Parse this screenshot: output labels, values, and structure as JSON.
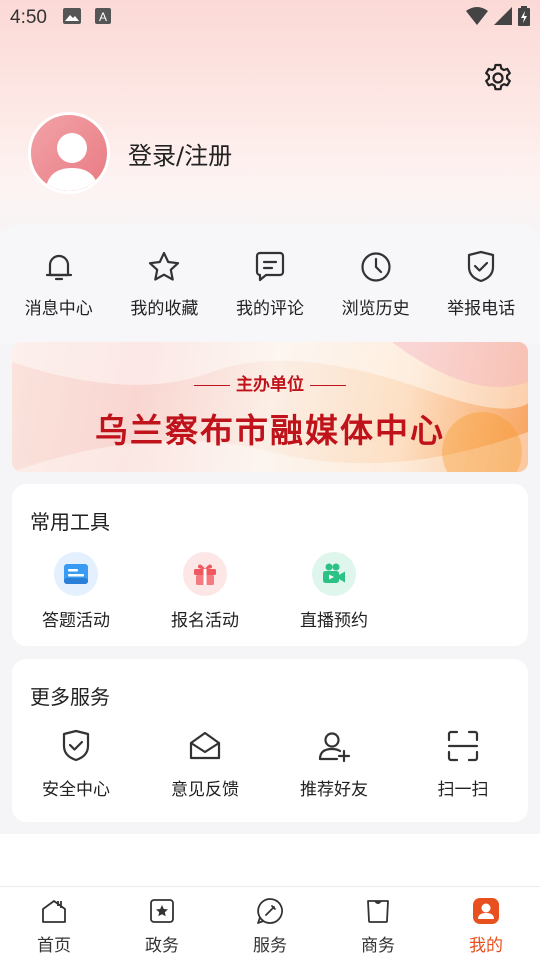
{
  "status_bar": {
    "time": "4:50",
    "icons_left": [
      "image-icon",
      "a-icon"
    ],
    "icons_right": [
      "wifi-icon",
      "signal-icon",
      "battery-icon"
    ]
  },
  "header": {
    "settings_icon": "gear-icon",
    "login_label": "登录/注册"
  },
  "quick_actions": [
    {
      "label": "消息中心",
      "icon": "bell-icon"
    },
    {
      "label": "我的收藏",
      "icon": "star-icon"
    },
    {
      "label": "我的评论",
      "icon": "comment-icon"
    },
    {
      "label": "浏览历史",
      "icon": "clock-icon"
    },
    {
      "label": "举报电话",
      "icon": "shield-check-icon"
    }
  ],
  "banner": {
    "subtitle": "主办单位",
    "title": "乌兰察布市融媒体中心"
  },
  "tools": {
    "title": "常用工具",
    "items": [
      {
        "label": "答题活动",
        "icon": "quiz-icon",
        "color": "#2f8ff0",
        "bg": "#e4f0fd"
      },
      {
        "label": "报名活动",
        "icon": "gift-icon",
        "color": "#f1575f",
        "bg": "#fde6e6"
      },
      {
        "label": "直播预约",
        "icon": "video-camera-icon",
        "color": "#2cc185",
        "bg": "#def6ec"
      }
    ]
  },
  "services": {
    "title": "更多服务",
    "items": [
      {
        "label": "安全中心",
        "icon": "shield-check-icon"
      },
      {
        "label": "意见反馈",
        "icon": "envelope-open-icon"
      },
      {
        "label": "推荐好友",
        "icon": "user-add-icon"
      },
      {
        "label": "扫一扫",
        "icon": "scan-icon"
      }
    ]
  },
  "tab_bar": {
    "active": "我的",
    "active_color": "#e8501f",
    "items": [
      {
        "label": "首页",
        "icon": "home-icon"
      },
      {
        "label": "政务",
        "icon": "government-icon"
      },
      {
        "label": "服务",
        "icon": "service-icon"
      },
      {
        "label": "商务",
        "icon": "business-icon"
      },
      {
        "label": "我的",
        "icon": "profile-icon"
      }
    ]
  }
}
